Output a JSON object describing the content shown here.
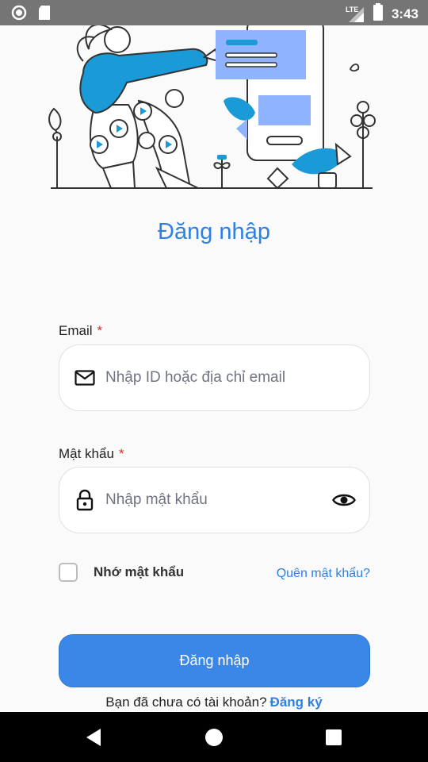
{
  "status_bar": {
    "time": "3:43",
    "network": "LTE",
    "icons": [
      "notification-circle-icon",
      "sd-card-icon",
      "signal-icon",
      "battery-icon"
    ]
  },
  "login": {
    "title": "Đăng nhập",
    "email": {
      "label": "Email",
      "required_mark": "*",
      "placeholder": "Nhập ID hoặc địa chỉ email",
      "value": "",
      "icon": "mail-icon"
    },
    "password": {
      "label": "Mật khẩu",
      "required_mark": "*",
      "placeholder": "Nhập mật khẩu",
      "value": "",
      "icon": "lock-icon",
      "toggle_icon": "eye-icon"
    },
    "remember_label": "Nhớ mật khẩu",
    "remember_checked": false,
    "forgot_label": "Quên mật khẩu?",
    "submit_label": "Đăng nhập",
    "signup_prompt": "Bạn đã chưa có tài khoản?",
    "signup_link": "Đăng ký"
  },
  "colors": {
    "accent": "#2f80e4",
    "button": "#3b87e8",
    "required": "#d32f2f",
    "illustration_blue": "#1a9ad6",
    "illustration_light": "#8fb3ff"
  },
  "nav_bar": {
    "icons": [
      "back-icon",
      "home-icon",
      "recents-icon"
    ]
  }
}
